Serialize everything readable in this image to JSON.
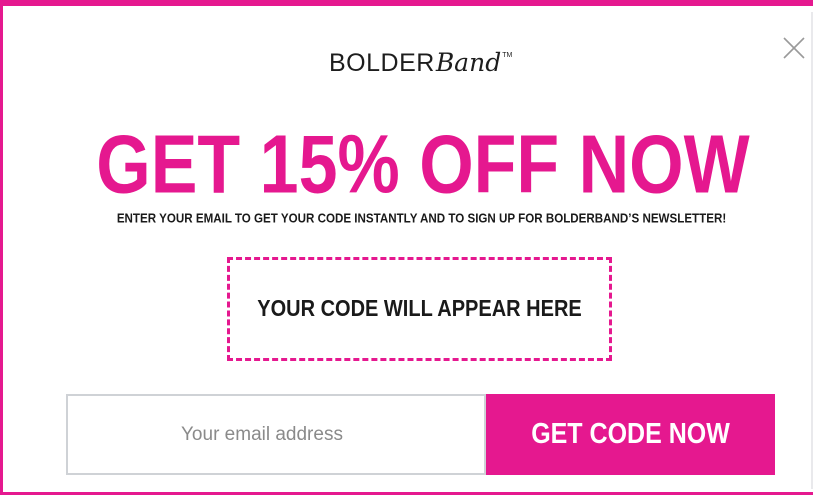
{
  "logo": {
    "bold": "BOLDER",
    "script": "Band",
    "tm": "TM"
  },
  "headline": "GET 15% OFF NOW",
  "subheadline": "ENTER YOUR EMAIL TO GET YOUR CODE INSTANTLY AND TO SIGN UP FOR BOLDERBAND’S NEWSLETTER!",
  "code_placeholder": "YOUR CODE WILL APPEAR HERE",
  "email": {
    "placeholder": "Your email address",
    "value": ""
  },
  "cta_label": "GET CODE NOW",
  "icons": {
    "close": "close-icon"
  },
  "colors": {
    "accent": "#e5188f",
    "text": "#1a1a1a",
    "input_border": "#cfd2d6",
    "placeholder": "#8a8a8a"
  }
}
